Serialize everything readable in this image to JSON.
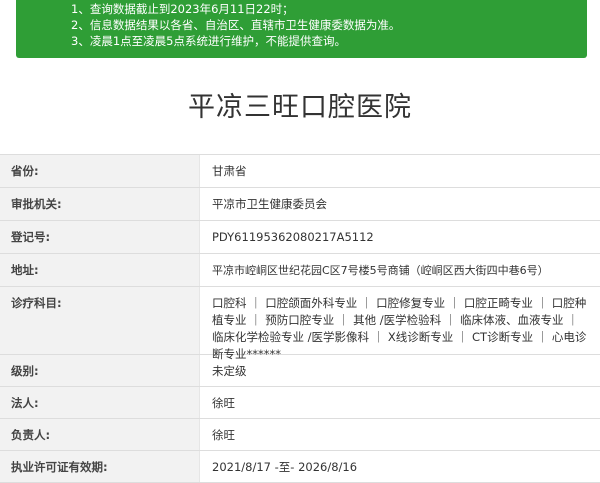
{
  "notice": {
    "lines": [
      "1、查询数据截止到2023年6月11日22时；",
      "2、信息数据结果以各省、自治区、直辖市卫生健康委数据为准。",
      "3、凌晨1点至凌晨5点系统进行维护，不能提供查询。"
    ]
  },
  "hospital": {
    "name": "平凉三旺口腔医院"
  },
  "fields": [
    {
      "label": "省份:",
      "value": "甘肃省"
    },
    {
      "label": "审批机关:",
      "value": "平凉市卫生健康委员会"
    },
    {
      "label": "登记号:",
      "value": "PDY61195362080217A5112"
    },
    {
      "label": "地址:",
      "value": "平凉市崆峒区世纪花园C区7号楼5号商铺（崆峒区西大街四中巷6号）"
    },
    {
      "label": "诊疗科目:",
      "value": "口腔科 ｜ 口腔颌面外科专业 ｜ 口腔修复专业 ｜ 口腔正畸专业 ｜ 口腔种植专业 ｜ 预防口腔专业 ｜ 其他 /医学检验科 ｜ 临床体液、血液专业 ｜ 临床化学检验专业 /医学影像科 ｜ X线诊断专业 ｜ CT诊断专业 ｜ 心电诊断专业******"
    },
    {
      "label": "级别:",
      "value": "未定级"
    },
    {
      "label": "法人:",
      "value": "徐旺"
    },
    {
      "label": "负责人:",
      "value": "徐旺"
    },
    {
      "label": "执业许可证有效期:",
      "value": "2021/8/17 -至- 2026/8/16"
    }
  ],
  "colors": {
    "notice_bg": "#2f9e36",
    "label_bg": "#f2f2f2",
    "border": "#dddddd"
  }
}
